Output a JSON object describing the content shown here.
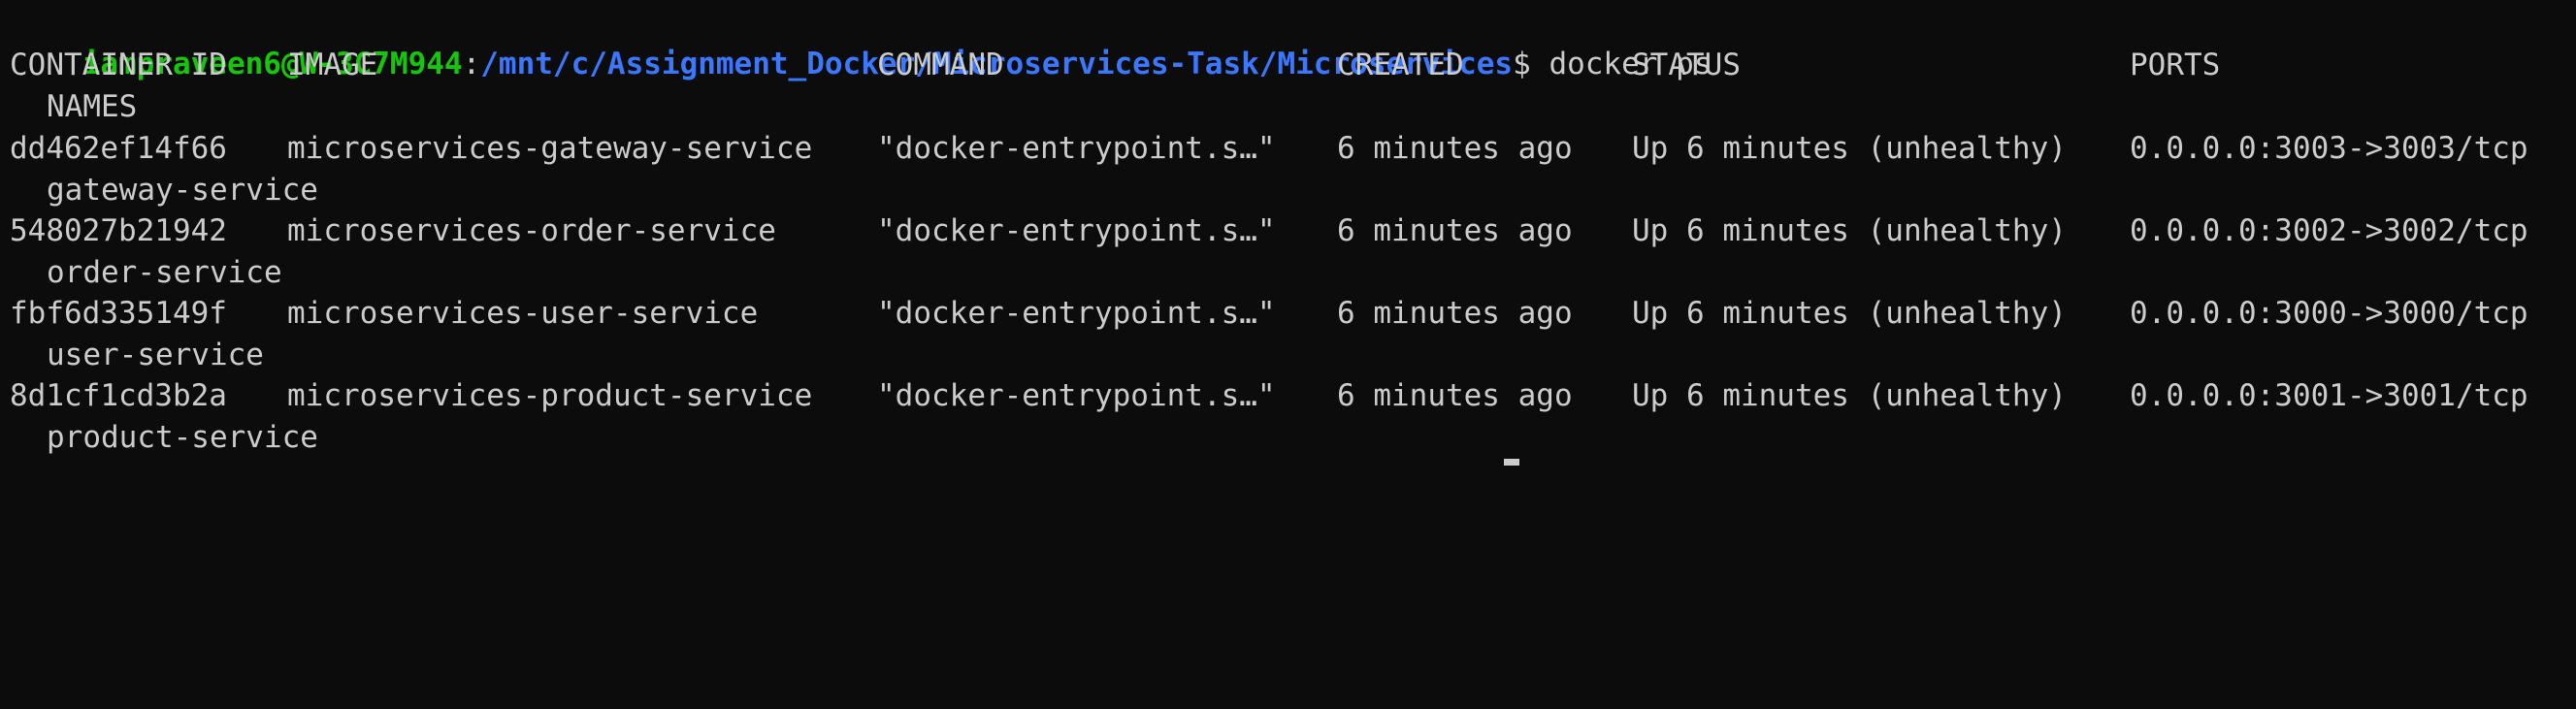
{
  "prompt": {
    "user_host": "iampraveen6@W-3C7M944",
    "separator": ":",
    "path": "/mnt/c/Assignment_Docker/Microservices-Task/Microservices",
    "symbol": "$",
    "command": "docker ps"
  },
  "headers": {
    "container_id": "CONTAINER ID",
    "image": "IMAGE",
    "command": "COMMAND",
    "created": "CREATED",
    "status": "STATUS",
    "ports": "PORTS",
    "names": "NAMES"
  },
  "rows": [
    {
      "container_id": "dd462ef14f66",
      "image": "microservices-gateway-service",
      "command": "\"docker-entrypoint.s…\"",
      "created": "6 minutes ago",
      "status": "Up 6 minutes (unhealthy)",
      "ports": "0.0.0.0:3003->3003/tcp",
      "name": "gateway-service"
    },
    {
      "container_id": "548027b21942",
      "image": "microservices-order-service",
      "command": "\"docker-entrypoint.s…\"",
      "created": "6 minutes ago",
      "status": "Up 6 minutes (unhealthy)",
      "ports": "0.0.0.0:3002->3002/tcp",
      "name": "order-service"
    },
    {
      "container_id": "fbf6d335149f",
      "image": "microservices-user-service",
      "command": "\"docker-entrypoint.s…\"",
      "created": "6 minutes ago",
      "status": "Up 6 minutes (unhealthy)",
      "ports": "0.0.0.0:3000->3000/tcp",
      "name": "user-service"
    },
    {
      "container_id": "8d1cf1cd3b2a",
      "image": "microservices-product-service",
      "command": "\"docker-entrypoint.s…\"",
      "created": "6 minutes ago",
      "status": "Up 6 minutes (unhealthy)",
      "ports": "0.0.0.0:3001->3001/tcp",
      "name": "product-service"
    }
  ],
  "colors": {
    "background": "#0c0c0c",
    "foreground": "#cccccc",
    "prompt_user": "#16c60c",
    "prompt_path": "#3b78ff"
  }
}
